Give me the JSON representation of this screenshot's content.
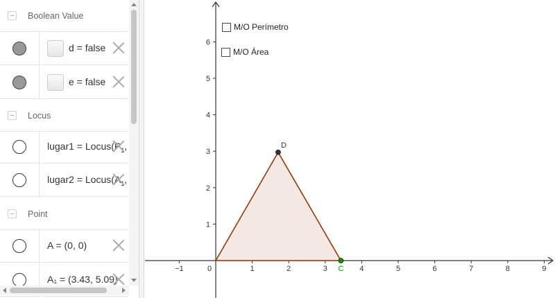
{
  "algebra": {
    "groups": [
      {
        "label": "Boolean Value"
      },
      {
        "label": "Locus"
      },
      {
        "label": "Point"
      }
    ],
    "rows": [
      {
        "text": "d = false",
        "has_checkbox": true,
        "marble": "filled"
      },
      {
        "text": "e = false",
        "has_checkbox": true,
        "marble": "filled"
      },
      {
        "text": "lugar1 = Locus(P_1,",
        "display": "lugar1 = Locus(P_1,",
        "marble": "empty"
      },
      {
        "text": "lugar2 = Locus(A_1,",
        "display": "lugar2 = Locus(A_1,",
        "marble": "empty"
      },
      {
        "text": "A = (0, 0)",
        "marble": "empty"
      },
      {
        "text": "A₁ = (3.43, 5.09)",
        "marble": "empty"
      }
    ]
  },
  "graphics": {
    "checkboxes": [
      {
        "label": "M/O Perímetro"
      },
      {
        "label": "M/O Área"
      }
    ],
    "points": [
      {
        "name": "D",
        "x": 1.71,
        "y": 2.97,
        "color": "#333333"
      },
      {
        "name": "C",
        "x": 3.43,
        "y": 0,
        "color": "#009900"
      }
    ]
  },
  "chart_data": {
    "type": "scatter",
    "x_ticks": [
      "−1",
      "0",
      "1",
      "2",
      "3",
      "4",
      "5",
      "6",
      "7",
      "8",
      "9"
    ],
    "y_ticks": [
      "1",
      "2",
      "3",
      "4",
      "5",
      "6"
    ],
    "xlim": [
      -1.95,
      9.3
    ],
    "ylim": [
      -1.0,
      7.2
    ],
    "triangle": [
      [
        0,
        0
      ],
      [
        3.43,
        0
      ],
      [
        1.71,
        2.97
      ]
    ],
    "triangle_stroke": "#993300",
    "triangle_fill": "#f4e8e4"
  }
}
